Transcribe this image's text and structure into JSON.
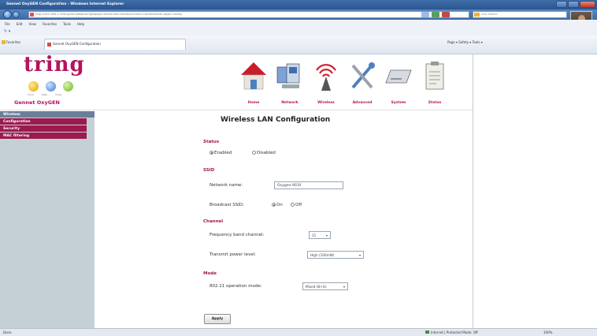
{
  "browser": {
    "window_title": "Gennet OxyGEN Configuration - Windows Internet Explorer",
    "url": "http://192.168.1.254/cgi-bin/webproc?getpage=html/index.html&var:menu=wireless&var:page=config",
    "search_placeholder": "Live Search",
    "menu": [
      "File",
      "Edit",
      "View",
      "Favorites",
      "Tools",
      "Help"
    ],
    "favorites_label": "Favorites",
    "tab_title": "Gennet OxyGEN Configuration",
    "toolbar_right": "Page ▾  Safety ▾  Tools ▾",
    "status_left": "Done",
    "status_zone": "Internet | Protected Mode: Off",
    "status_zoom": "100%"
  },
  "header": {
    "logo_text": "tring",
    "logo_dot_labels": [
      "Voice",
      "Data",
      "Video"
    ],
    "brand_name": "Gennet OxyGEN",
    "nav": [
      {
        "label": "Home",
        "icon": "home-icon"
      },
      {
        "label": "Network",
        "icon": "network-icon"
      },
      {
        "label": "Wireless",
        "icon": "wireless-antenna-icon"
      },
      {
        "label": "Advanced",
        "icon": "tools-icon"
      },
      {
        "label": "System",
        "icon": "system-icon"
      },
      {
        "label": "Status",
        "icon": "clipboard-icon"
      }
    ]
  },
  "sidebar": {
    "heading": "Wireless",
    "items": [
      "Configuration",
      "Security",
      "MAC filtering"
    ]
  },
  "content": {
    "title": "Wireless LAN Configuration",
    "status": {
      "heading": "Status",
      "options": [
        "Enabled",
        "Disabled"
      ],
      "selected": "Enabled"
    },
    "ssid": {
      "heading": "SSID",
      "network_name_label": "Network name:",
      "network_name_value": "Oxygen-9010",
      "broadcast_label": "Broadcast SSID:",
      "broadcast_options": [
        "On",
        "Off"
      ],
      "broadcast_selected": "On"
    },
    "channel": {
      "heading": "Channel",
      "frequency_label": "Frequency band channel:",
      "frequency_value": "11",
      "power_label": "Transmit power level:",
      "power_value": "High (100mW)"
    },
    "mode": {
      "heading": "Mode",
      "operation_label": "802.11 operation mode:",
      "operation_value": "Mixed (B+G)"
    },
    "apply_label": "Apply"
  }
}
